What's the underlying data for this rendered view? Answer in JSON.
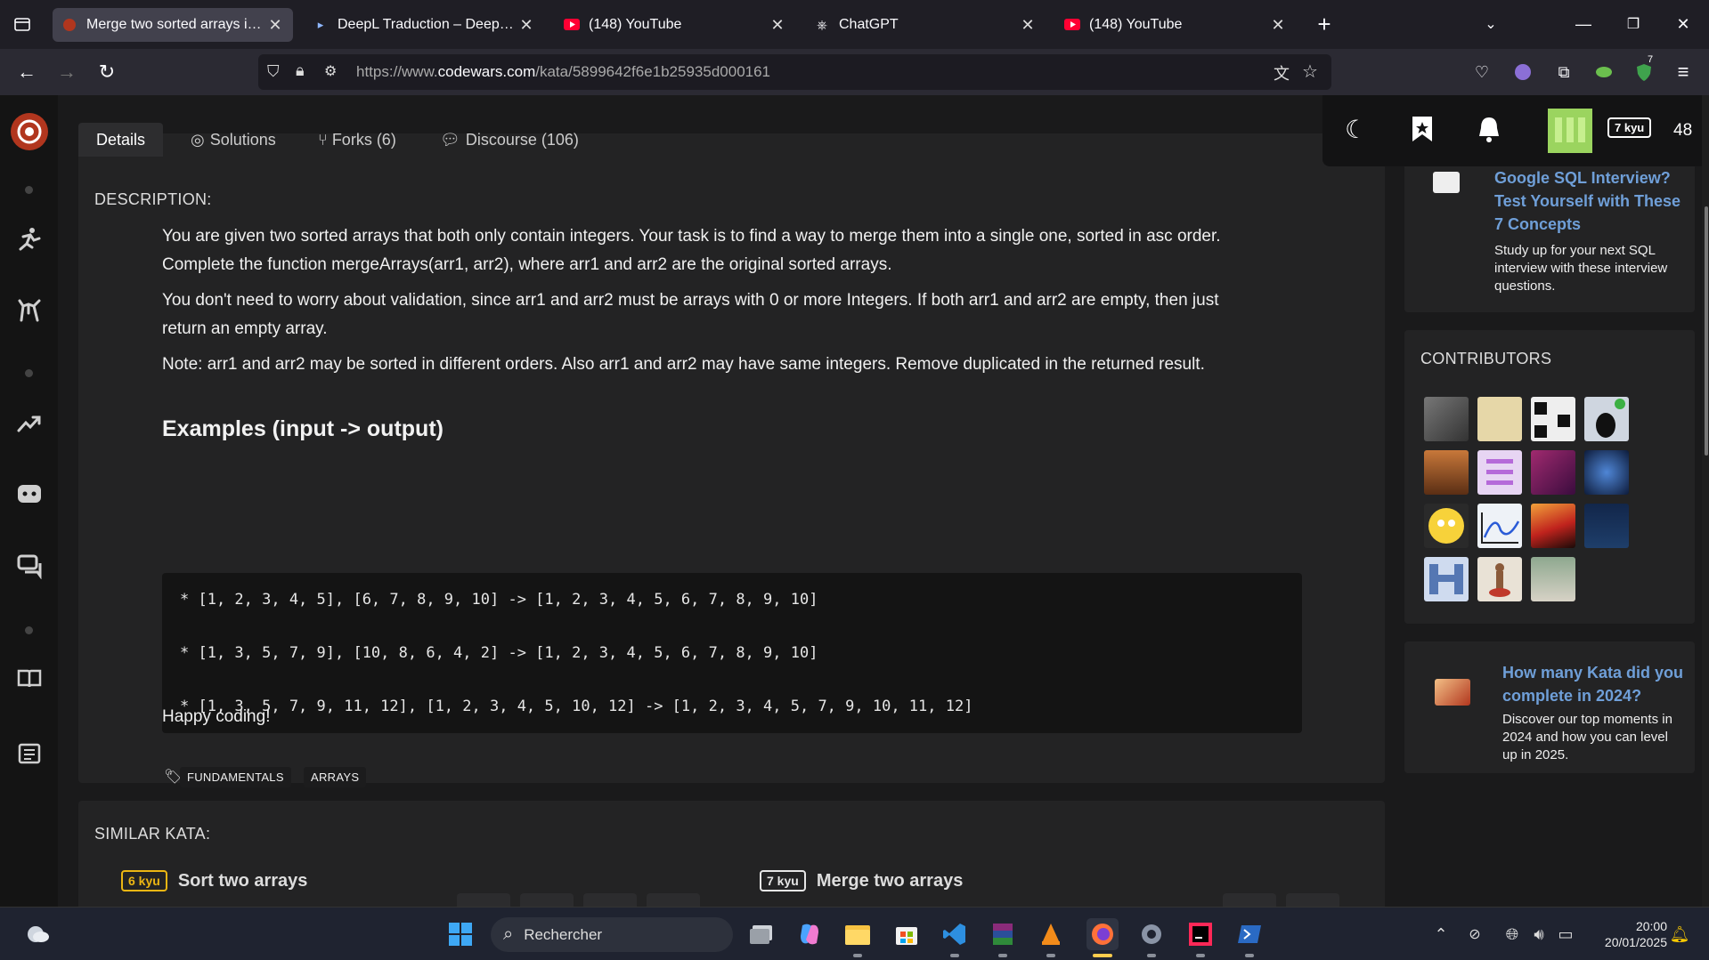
{
  "browser": {
    "tabs": [
      {
        "title": "Merge two sorted arrays into o",
        "active": true,
        "icon": "codewars-icon"
      },
      {
        "title": "DeepL Traduction – DeepL Tran",
        "active": false,
        "icon": "deepl-icon"
      },
      {
        "title": "(148) YouTube",
        "active": false,
        "icon": "youtube-icon"
      },
      {
        "title": "ChatGPT",
        "active": false,
        "icon": "chatgpt-icon"
      },
      {
        "title": "(148) YouTube",
        "active": false,
        "icon": "youtube-icon"
      }
    ],
    "url_prefix": "https://www.",
    "url_domain": "codewars.com",
    "url_path": "/kata/5899642f6e1b25935d000161",
    "extension_badge": "7"
  },
  "page_tabs": {
    "details": "Details",
    "solutions": "Solutions",
    "forks": "Forks (6)",
    "discourse": "Discourse (106)"
  },
  "header_user": {
    "rank": "7 kyu",
    "honor": "48"
  },
  "description": {
    "heading": "DESCRIPTION:",
    "p1_line1": "You are given two sorted arrays that both only contain integers. Your task is to find a way to merge them into a single one, sorted in asc order.",
    "p1_line2": "Complete the function mergeArrays(arr1, arr2), where arr1 and arr2 are the original sorted arrays.",
    "p2_line1": "You don't need to worry about validation, since arr1 and arr2 must be arrays with 0 or more Integers. If both arr1 and arr2 are empty, then just",
    "p2_line2": "return an empty array.",
    "p3": "Note: arr1 and arr2 may be sorted in different orders. Also arr1 and arr2 may have same integers. Remove duplicated in the returned result.",
    "examples_heading": "Examples (input -> output)",
    "code": [
      "* [1, 2, 3, 4, 5], [6, 7, 8, 9, 10] -> [1, 2, 3, 4, 5, 6, 7, 8, 9, 10]",
      "* [1, 3, 5, 7, 9], [10, 8, 6, 4, 2] -> [1, 2, 3, 4, 5, 6, 7, 8, 9, 10]",
      "* [1, 3, 5, 7, 9, 11, 12], [1, 2, 3, 4, 5, 10, 12] -> [1, 2, 3, 4, 5, 7, 9, 10, 11, 12]"
    ],
    "closing": "Happy coding!",
    "tags": [
      "FUNDAMENTALS",
      "ARRAYS"
    ]
  },
  "similar": {
    "heading": "SIMILAR KATA:",
    "items": [
      {
        "rank": "6 kyu",
        "title": "Sort two arrays",
        "color": "#ecb613"
      },
      {
        "rank": "7 kyu",
        "title": "Merge two arrays",
        "color": "#e6e6e6"
      }
    ]
  },
  "sidebar": {
    "ad1_title": "Google SQL Interview? Test Yourself with These 7 Concepts",
    "ad1_body": "Study up for your next SQL interview with these interview questions.",
    "contributors_heading": "CONTRIBUTORS",
    "ad2_title": "How many Kata did you complete in 2024?",
    "ad2_body": "Discover our top moments in 2024 and how you can level up in 2025."
  },
  "taskbar": {
    "search_placeholder": "Rechercher",
    "time": "20:00",
    "date": "20/01/2025"
  },
  "colors": {
    "codewars_red": "#b1361e",
    "link_blue": "#6f9fd8",
    "kyu6": "#ecb613"
  }
}
